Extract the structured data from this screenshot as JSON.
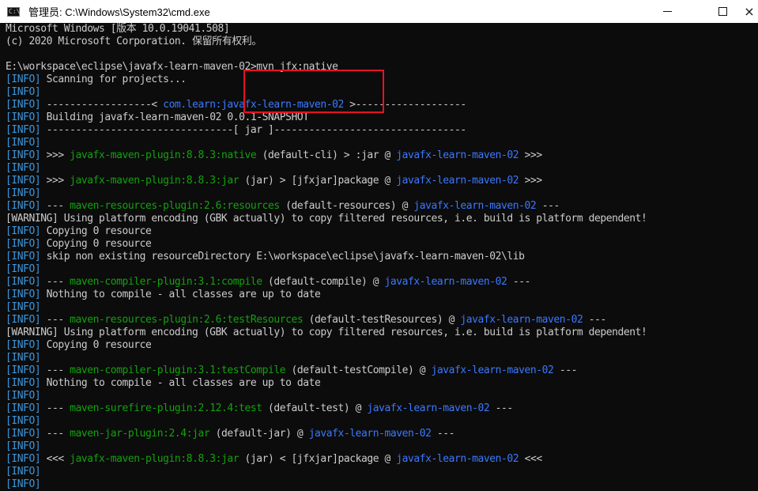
{
  "window": {
    "title": "管理员: C:\\Windows\\System32\\cmd.exe",
    "icon": "cmd-icon",
    "controls": {
      "minimize": "minimize-icon",
      "maximize": "maximize-icon",
      "close": "×"
    }
  },
  "colors": {
    "info": "#3a96dd",
    "plugin": "#13a10e",
    "project": "#3b78ff",
    "text": "#cccccc",
    "background": "#0c0c0c",
    "highlight": "#e81123"
  },
  "console": {
    "lines": [
      [
        {
          "t": "Microsoft Windows [版本 10.0.19041.508]"
        }
      ],
      [
        {
          "t": "(c) 2020 Microsoft Corporation. 保留所有权利。"
        }
      ],
      [
        {
          "t": ""
        }
      ],
      [
        {
          "t": "E:\\workspace\\eclipse\\javafx-learn-maven-02>mvn jfx:native"
        }
      ],
      [
        {
          "t": "[INFO]",
          "c": "info"
        },
        {
          "t": " Scanning for projects..."
        }
      ],
      [
        {
          "t": "[INFO]",
          "c": "info"
        }
      ],
      [
        {
          "t": "[INFO]",
          "c": "info"
        },
        {
          "t": " ------------------< "
        },
        {
          "t": "com.learn:javafx-learn-maven-02",
          "c": "proj"
        },
        {
          "t": " >-------------------"
        }
      ],
      [
        {
          "t": "[INFO]",
          "c": "info"
        },
        {
          "t": " Building javafx-learn-maven-02 0.0.1-SNAPSHOT"
        }
      ],
      [
        {
          "t": "[INFO]",
          "c": "info"
        },
        {
          "t": " --------------------------------[ jar ]---------------------------------"
        }
      ],
      [
        {
          "t": "[INFO]",
          "c": "info"
        }
      ],
      [
        {
          "t": "[INFO]",
          "c": "info"
        },
        {
          "t": " >>> "
        },
        {
          "t": "javafx-maven-plugin:8.8.3:native",
          "c": "plugin"
        },
        {
          "t": " (default-cli) > :jar @ "
        },
        {
          "t": "javafx-learn-maven-02",
          "c": "proj"
        },
        {
          "t": " >>>"
        }
      ],
      [
        {
          "t": "[INFO]",
          "c": "info"
        }
      ],
      [
        {
          "t": "[INFO]",
          "c": "info"
        },
        {
          "t": " >>> "
        },
        {
          "t": "javafx-maven-plugin:8.8.3:jar",
          "c": "plugin"
        },
        {
          "t": " (jar) > [jfxjar]package @ "
        },
        {
          "t": "javafx-learn-maven-02",
          "c": "proj"
        },
        {
          "t": " >>>"
        }
      ],
      [
        {
          "t": "[INFO]",
          "c": "info"
        }
      ],
      [
        {
          "t": "[INFO]",
          "c": "info"
        },
        {
          "t": " --- "
        },
        {
          "t": "maven-resources-plugin:2.6:resources",
          "c": "plugin"
        },
        {
          "t": " (default-resources) @ "
        },
        {
          "t": "javafx-learn-maven-02",
          "c": "proj"
        },
        {
          "t": " ---"
        }
      ],
      [
        {
          "t": "[WARNING]",
          "c": "warn"
        },
        {
          "t": " Using platform encoding (GBK actually) to copy filtered resources, i.e. build is platform dependent!"
        }
      ],
      [
        {
          "t": "[INFO]",
          "c": "info"
        },
        {
          "t": " Copying 0 resource"
        }
      ],
      [
        {
          "t": "[INFO]",
          "c": "info"
        },
        {
          "t": " Copying 0 resource"
        }
      ],
      [
        {
          "t": "[INFO]",
          "c": "info"
        },
        {
          "t": " skip non existing resourceDirectory E:\\workspace\\eclipse\\javafx-learn-maven-02\\lib"
        }
      ],
      [
        {
          "t": "[INFO]",
          "c": "info"
        }
      ],
      [
        {
          "t": "[INFO]",
          "c": "info"
        },
        {
          "t": " --- "
        },
        {
          "t": "maven-compiler-plugin:3.1:compile",
          "c": "plugin"
        },
        {
          "t": " (default-compile) @ "
        },
        {
          "t": "javafx-learn-maven-02",
          "c": "proj"
        },
        {
          "t": " ---"
        }
      ],
      [
        {
          "t": "[INFO]",
          "c": "info"
        },
        {
          "t": " Nothing to compile - all classes are up to date"
        }
      ],
      [
        {
          "t": "[INFO]",
          "c": "info"
        }
      ],
      [
        {
          "t": "[INFO]",
          "c": "info"
        },
        {
          "t": " --- "
        },
        {
          "t": "maven-resources-plugin:2.6:testResources",
          "c": "plugin"
        },
        {
          "t": " (default-testResources) @ "
        },
        {
          "t": "javafx-learn-maven-02",
          "c": "proj"
        },
        {
          "t": " ---"
        }
      ],
      [
        {
          "t": "[WARNING]",
          "c": "warn"
        },
        {
          "t": " Using platform encoding (GBK actually) to copy filtered resources, i.e. build is platform dependent!"
        }
      ],
      [
        {
          "t": "[INFO]",
          "c": "info"
        },
        {
          "t": " Copying 0 resource"
        }
      ],
      [
        {
          "t": "[INFO]",
          "c": "info"
        }
      ],
      [
        {
          "t": "[INFO]",
          "c": "info"
        },
        {
          "t": " --- "
        },
        {
          "t": "maven-compiler-plugin:3.1:testCompile",
          "c": "plugin"
        },
        {
          "t": " (default-testCompile) @ "
        },
        {
          "t": "javafx-learn-maven-02",
          "c": "proj"
        },
        {
          "t": " ---"
        }
      ],
      [
        {
          "t": "[INFO]",
          "c": "info"
        },
        {
          "t": " Nothing to compile - all classes are up to date"
        }
      ],
      [
        {
          "t": "[INFO]",
          "c": "info"
        }
      ],
      [
        {
          "t": "[INFO]",
          "c": "info"
        },
        {
          "t": " --- "
        },
        {
          "t": "maven-surefire-plugin:2.12.4:test",
          "c": "plugin"
        },
        {
          "t": " (default-test) @ "
        },
        {
          "t": "javafx-learn-maven-02",
          "c": "proj"
        },
        {
          "t": " ---"
        }
      ],
      [
        {
          "t": "[INFO]",
          "c": "info"
        }
      ],
      [
        {
          "t": "[INFO]",
          "c": "info"
        },
        {
          "t": " --- "
        },
        {
          "t": "maven-jar-plugin:2.4:jar",
          "c": "plugin"
        },
        {
          "t": " (default-jar) @ "
        },
        {
          "t": "javafx-learn-maven-02",
          "c": "proj"
        },
        {
          "t": " ---"
        }
      ],
      [
        {
          "t": "[INFO]",
          "c": "info"
        }
      ],
      [
        {
          "t": "[INFO]",
          "c": "info"
        },
        {
          "t": " <<< "
        },
        {
          "t": "javafx-maven-plugin:8.8.3:jar",
          "c": "plugin"
        },
        {
          "t": " (jar) < [jfxjar]package @ "
        },
        {
          "t": "javafx-learn-maven-02",
          "c": "proj"
        },
        {
          "t": " <<<"
        }
      ],
      [
        {
          "t": "[INFO]",
          "c": "info"
        }
      ],
      [
        {
          "t": "[INFO]",
          "c": "info"
        }
      ]
    ]
  }
}
